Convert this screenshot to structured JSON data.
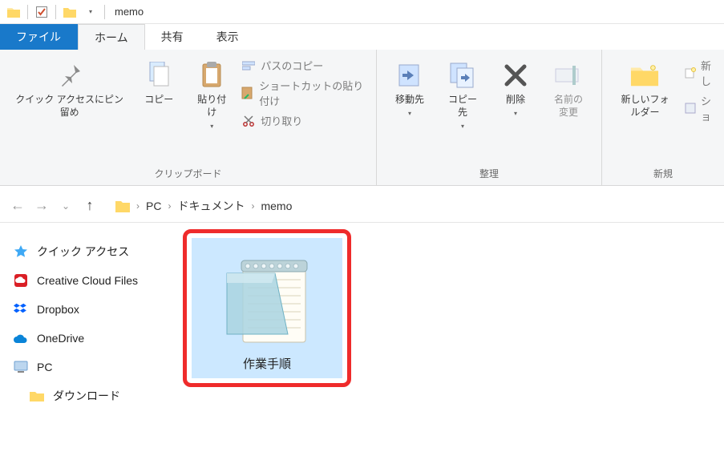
{
  "title": "memo",
  "tabs": {
    "file": "ファイル",
    "home": "ホーム",
    "share": "共有",
    "view": "表示"
  },
  "ribbon": {
    "quickaccess": "クイック アクセスにピン留め",
    "copy": "コピー",
    "paste": "貼り付け",
    "path_copy": "パスのコピー",
    "paste_shortcut": "ショートカットの貼り付け",
    "cut": "切り取り",
    "clipboard_label": "クリップボード",
    "move_to": "移動先",
    "copy_to": "コピー先",
    "delete": "削除",
    "rename": "名前の変更",
    "organize_label": "整理",
    "new_folder": "新しいフォルダー",
    "new_item": "新し",
    "show": "ショ",
    "new_label": "新規"
  },
  "breadcrumbs": {
    "pc": "PC",
    "documents": "ドキュメント",
    "folder": "memo"
  },
  "sidebar": {
    "items": [
      {
        "label": "クイック アクセス"
      },
      {
        "label": "Creative Cloud Files"
      },
      {
        "label": "Dropbox"
      },
      {
        "label": "OneDrive"
      },
      {
        "label": "PC"
      },
      {
        "label": "ダウンロード"
      }
    ]
  },
  "file": {
    "name": "作業手順"
  }
}
